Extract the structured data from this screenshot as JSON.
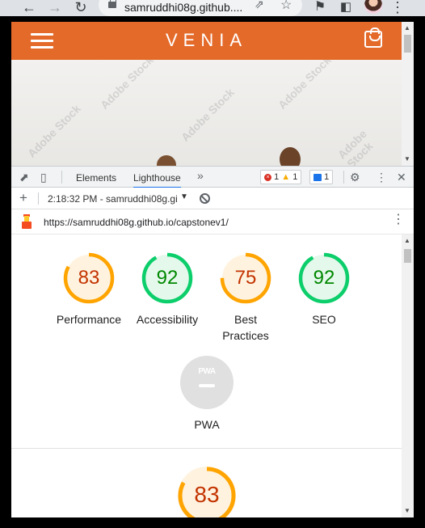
{
  "browser": {
    "url": "samruddhi08g.github....",
    "nav_back_icon": "arrow-left-icon",
    "nav_forward_icon": "arrow-right-icon",
    "reload_icon": "reload-icon"
  },
  "site": {
    "brand": "VENIA",
    "header_color": "#e46a2a"
  },
  "devtools": {
    "tabs": [
      "Elements",
      "Lighthouse"
    ],
    "active_tab": "Lighthouse",
    "more_tabs": "»",
    "errors": "1",
    "warnings": "1",
    "messages": "1"
  },
  "lighthouse": {
    "report_select": "2:18:32 PM - samruddhi08g.gi",
    "report_url": "https://samruddhi08g.github.io/capstonev1/",
    "scores": [
      {
        "name": "Performance",
        "value": "83",
        "status": "average"
      },
      {
        "name": "Accessibility",
        "value": "92",
        "status": "pass"
      },
      {
        "name": "Best Practices",
        "line1": "Best",
        "line2": "Practices",
        "value": "75",
        "status": "average"
      },
      {
        "name": "SEO",
        "value": "92",
        "status": "pass"
      }
    ],
    "pwa": {
      "label": "PWA",
      "badge": "PWA"
    },
    "performance_big": "83"
  },
  "colors": {
    "average": "#ffa400",
    "average_text": "#c33300",
    "average_bg": "#fff3e0",
    "pass": "#0cce6b",
    "pass_text": "#008800",
    "pass_bg": "#e5f8ec"
  }
}
